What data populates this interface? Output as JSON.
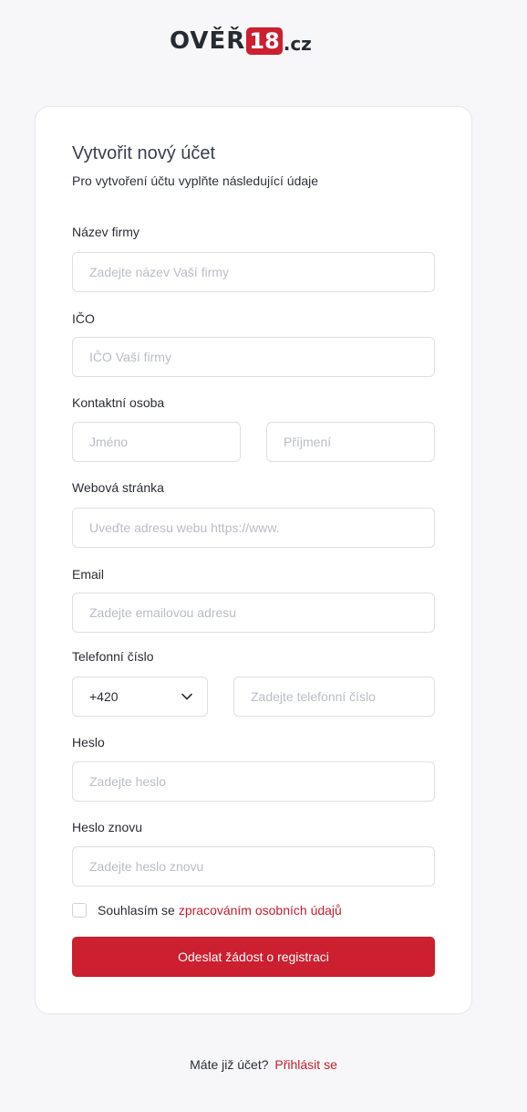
{
  "logo": {
    "word": "OVĚŘ",
    "badge": "18",
    "tld": ".cz"
  },
  "form": {
    "title": "Vytvořit nový účet",
    "subtitle": "Pro vytvoření účtu vyplňte následující údaje",
    "company_name": {
      "label": "Název firmy",
      "placeholder": "Zadejte název Vaší firmy",
      "value": ""
    },
    "ico": {
      "label": "IČO",
      "placeholder": "IČO Vaší firmy",
      "value": ""
    },
    "contact": {
      "label": "Kontaktní osoba",
      "first_placeholder": "Jméno",
      "last_placeholder": "Příjmení"
    },
    "website": {
      "label": "Webová stránka",
      "placeholder": "Uveďte adresu webu https://www."
    },
    "email": {
      "label": "Email",
      "placeholder": "Zadejte emailovou adresu"
    },
    "phone": {
      "label": "Telefonní číslo",
      "prefix": "+420",
      "placeholder": "Zadejte telefonní číslo"
    },
    "password": {
      "label": "Heslo",
      "placeholder": "Zadejte heslo"
    },
    "password_again": {
      "label": "Heslo znovu",
      "placeholder": "Zadejte heslo znovu"
    },
    "consent": {
      "text": "Souhlasím se",
      "link": "zpracováním osobních údajů",
      "checked": false
    },
    "submit_label": "Odeslat žádost o registraci"
  },
  "footer": {
    "text": "Máte již účet?",
    "link": "Přihlásit se"
  },
  "colors": {
    "accent": "#cc1f2f",
    "background": "#f7f7f9"
  }
}
